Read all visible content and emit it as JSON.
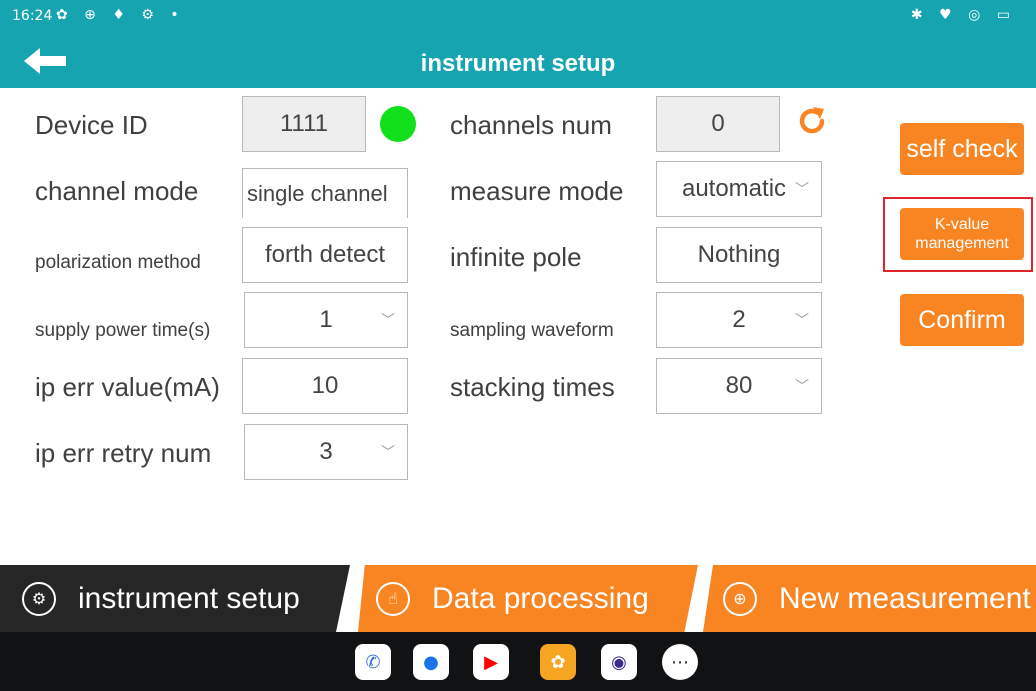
{
  "status_bar": {
    "time": "16:24",
    "left_icons": [
      "gear-icon",
      "settings-icon",
      "mic-icon",
      "gear-icon",
      "dot-icon"
    ],
    "right_icons": [
      "bluetooth-icon",
      "wifi-icon",
      "hotspot-icon",
      "battery-icon"
    ],
    "left_glyphs": "✿ ⊕ ♦ ⚙ •",
    "right_glyphs": "✱ ♥ ◎ ▭"
  },
  "header": {
    "title": "instrument setup",
    "back_icon": "arrow-left-icon"
  },
  "form": {
    "device_id_label": "Device ID",
    "device_id_value": "1111",
    "device_status_color": "#12e01b",
    "channels_num_label": "channels num",
    "channels_num_value": "0",
    "channel_mode_label": "channel mode",
    "channel_mode_value": "single channel",
    "measure_mode_label": "measure mode",
    "measure_mode_value": "automatic",
    "polarization_method_label": "polarization method",
    "polarization_method_value": "forth detect",
    "infinite_pole_label": "infinite pole",
    "infinite_pole_value": "Nothing",
    "supply_power_time_label": "supply power time(s)",
    "supply_power_time_value": "1",
    "sampling_waveform_label": "sampling waveform",
    "sampling_waveform_value": "2",
    "ip_err_value_label": "ip err value(mA)",
    "ip_err_value_value": "10",
    "stacking_times_label": "stacking times",
    "stacking_times_value": "80",
    "ip_err_retry_label": "ip err retry num",
    "ip_err_retry_value": "3",
    "dropdown_caret": "﹀"
  },
  "actions": {
    "self_check": "self check",
    "k_value_line1": "K-value",
    "k_value_line2": "management",
    "confirm": "Confirm"
  },
  "tabs": [
    {
      "label": "instrument setup",
      "icon": "gear-icon",
      "active": true
    },
    {
      "label": "Data processing",
      "icon": "hand-touch-icon",
      "active": false
    },
    {
      "label": "New measurement",
      "icon": "new-measurement-icon",
      "active": false
    }
  ],
  "tab_glyphs": [
    "⚙",
    "☝",
    "⊕"
  ],
  "dock": {
    "apps": [
      "phone-icon",
      "messages-icon",
      "youtube-icon",
      "settings-icon",
      "camera-icon",
      "app-drawer-icon"
    ],
    "glyphs": [
      "✆",
      "●",
      "▶",
      "✿",
      "◉",
      "⋯"
    ],
    "colors": [
      "#ffffff",
      "#ffffff",
      "#ffffff",
      "#f6a623",
      "#ffffff",
      "#ffffff"
    ]
  },
  "colors": {
    "header": "#17a4b1",
    "accent": "#f98422",
    "active_tab": "#262626",
    "highlight_outline": "#e0262b"
  }
}
